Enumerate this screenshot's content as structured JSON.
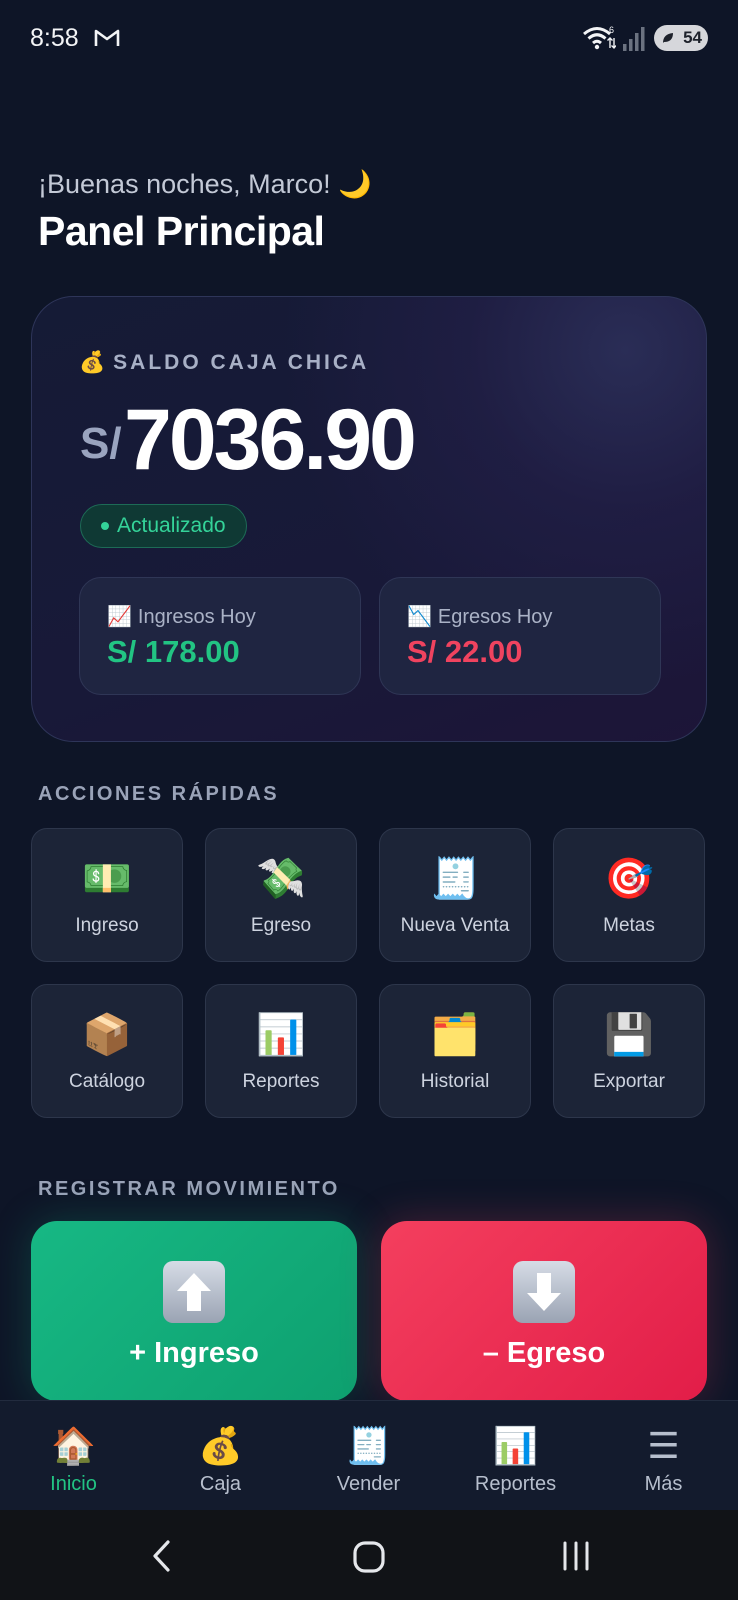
{
  "status_bar": {
    "time": "8:58",
    "battery": "54",
    "icons": [
      "gmail-icon",
      "wifi-icon",
      "signal-icon",
      "battery-icon"
    ]
  },
  "header": {
    "greeting": "¡Buenas noches, Marco! 🌙",
    "title": "Panel Principal"
  },
  "balance_card": {
    "label_emoji": "💰",
    "label": "SALDO CAJA CHICA",
    "currency": "S/",
    "amount": "7036.90",
    "status": "Actualizado",
    "income": {
      "emoji": "📈",
      "label": "Ingresos Hoy",
      "value": "S/ 178.00"
    },
    "expense": {
      "emoji": "📉",
      "label": "Egresos Hoy",
      "value": "S/ 22.00"
    }
  },
  "quick_actions": {
    "title": "ACCIONES RÁPIDAS",
    "items": [
      {
        "icon": "💵",
        "label": "Ingreso"
      },
      {
        "icon": "💸",
        "label": "Egreso"
      },
      {
        "icon": "🧾",
        "label": "Nueva Venta"
      },
      {
        "icon": "🎯",
        "label": "Metas"
      },
      {
        "icon": "📦",
        "label": "Catálogo"
      },
      {
        "icon": "📊",
        "label": "Reportes"
      },
      {
        "icon": "🗂️",
        "label": "Historial"
      },
      {
        "icon": "💾",
        "label": "Exportar"
      }
    ]
  },
  "register": {
    "title": "REGISTRAR MOVIMIENTO",
    "income_label": "+ Ingreso",
    "expense_label": "– Egreso"
  },
  "bottom_nav": [
    {
      "icon": "🏠",
      "label": "Inicio",
      "active": true
    },
    {
      "icon": "💰",
      "label": "Caja"
    },
    {
      "icon": "🧾",
      "label": "Vender"
    },
    {
      "icon": "📊",
      "label": "Reportes"
    },
    {
      "icon": "☰",
      "label": "Más"
    }
  ],
  "colors": {
    "background": "#0e1527",
    "income_green": "#22c483",
    "expense_red": "#f0435f",
    "accent_green_button": "#10b981",
    "accent_red_button": "#f43f5e"
  }
}
